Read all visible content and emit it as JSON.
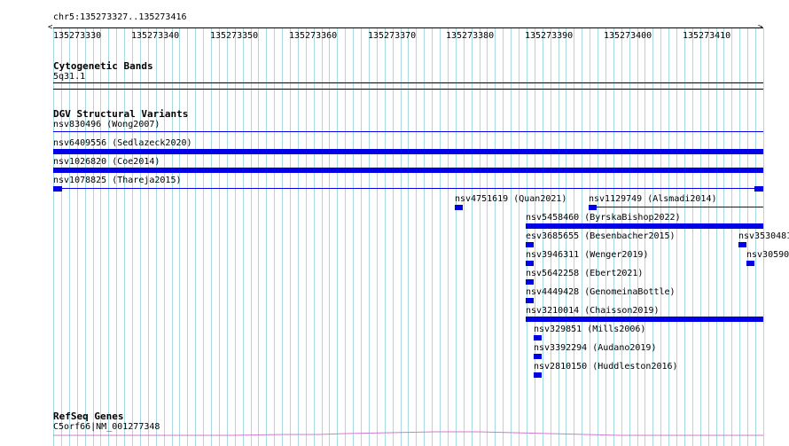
{
  "region": {
    "label": "chr5:135273327..135273416",
    "ticks": [
      "135273330",
      "135273340",
      "135273350",
      "135273360",
      "135273370",
      "135273380",
      "135273390",
      "135273400",
      "135273410"
    ]
  },
  "tracks": {
    "cytoband": {
      "title": "Cytogenetic Bands",
      "band": "5q31.1"
    },
    "dgv": {
      "title": "DGV Structural Variants",
      "features": [
        {
          "label": "nsv830496 (Wong2007)"
        },
        {
          "label": "nsv6409556 (Sedlazeck2020)"
        },
        {
          "label": "nsv1026820 (Coe2014)"
        },
        {
          "label": "nsv1078825 (Thareja2015)"
        },
        {
          "label": "nsv4751619 (Quan2021)"
        },
        {
          "label": "nsv1129749 (Alsmadi2014)"
        },
        {
          "label": "nsv5458460 (ByrskaBishop2022)"
        },
        {
          "label": "esv3685655 (Besenbacher2015)"
        },
        {
          "label": "nsv3530481"
        },
        {
          "label": "nsv3946311 (Wenger2019)"
        },
        {
          "label": "nsv30590"
        },
        {
          "label": "nsv5642258 (Ebert2021)"
        },
        {
          "label": "nsv4449428 (GenomeinaBottle)"
        },
        {
          "label": "nsv3210014 (Chaisson2019)"
        },
        {
          "label": "nsv329851 (Mills2006)"
        },
        {
          "label": "nsv3392294 (Audano2019)"
        },
        {
          "label": "nsv2810150 (Huddleston2016)"
        }
      ]
    },
    "refseq": {
      "title": "RefSeq Genes",
      "gene": "C5orf66|NM_001277348"
    }
  },
  "colors": {
    "feature": "#0000e6",
    "grid": "#a8d8e0",
    "gene": "#d07ad0"
  }
}
